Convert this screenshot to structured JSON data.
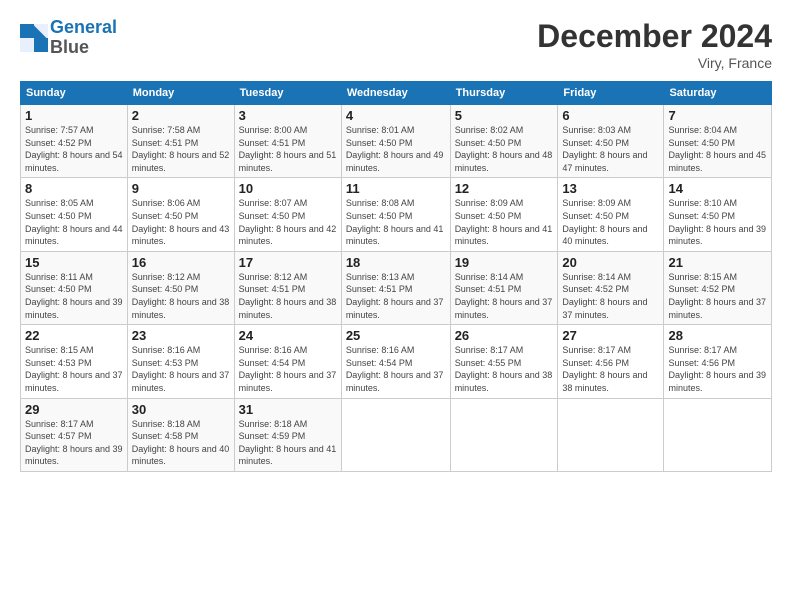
{
  "logo": {
    "line1": "General",
    "line2": "Blue"
  },
  "title": "December 2024",
  "location": "Viry, France",
  "headers": [
    "Sunday",
    "Monday",
    "Tuesday",
    "Wednesday",
    "Thursday",
    "Friday",
    "Saturday"
  ],
  "weeks": [
    [
      {
        "day": "1",
        "sunrise": "7:57 AM",
        "sunset": "4:52 PM",
        "daylight": "8 hours and 54 minutes."
      },
      {
        "day": "2",
        "sunrise": "7:58 AM",
        "sunset": "4:51 PM",
        "daylight": "8 hours and 52 minutes."
      },
      {
        "day": "3",
        "sunrise": "8:00 AM",
        "sunset": "4:51 PM",
        "daylight": "8 hours and 51 minutes."
      },
      {
        "day": "4",
        "sunrise": "8:01 AM",
        "sunset": "4:50 PM",
        "daylight": "8 hours and 49 minutes."
      },
      {
        "day": "5",
        "sunrise": "8:02 AM",
        "sunset": "4:50 PM",
        "daylight": "8 hours and 48 minutes."
      },
      {
        "day": "6",
        "sunrise": "8:03 AM",
        "sunset": "4:50 PM",
        "daylight": "8 hours and 47 minutes."
      },
      {
        "day": "7",
        "sunrise": "8:04 AM",
        "sunset": "4:50 PM",
        "daylight": "8 hours and 45 minutes."
      }
    ],
    [
      {
        "day": "8",
        "sunrise": "8:05 AM",
        "sunset": "4:50 PM",
        "daylight": "8 hours and 44 minutes."
      },
      {
        "day": "9",
        "sunrise": "8:06 AM",
        "sunset": "4:50 PM",
        "daylight": "8 hours and 43 minutes."
      },
      {
        "day": "10",
        "sunrise": "8:07 AM",
        "sunset": "4:50 PM",
        "daylight": "8 hours and 42 minutes."
      },
      {
        "day": "11",
        "sunrise": "8:08 AM",
        "sunset": "4:50 PM",
        "daylight": "8 hours and 41 minutes."
      },
      {
        "day": "12",
        "sunrise": "8:09 AM",
        "sunset": "4:50 PM",
        "daylight": "8 hours and 41 minutes."
      },
      {
        "day": "13",
        "sunrise": "8:09 AM",
        "sunset": "4:50 PM",
        "daylight": "8 hours and 40 minutes."
      },
      {
        "day": "14",
        "sunrise": "8:10 AM",
        "sunset": "4:50 PM",
        "daylight": "8 hours and 39 minutes."
      }
    ],
    [
      {
        "day": "15",
        "sunrise": "8:11 AM",
        "sunset": "4:50 PM",
        "daylight": "8 hours and 39 minutes."
      },
      {
        "day": "16",
        "sunrise": "8:12 AM",
        "sunset": "4:50 PM",
        "daylight": "8 hours and 38 minutes."
      },
      {
        "day": "17",
        "sunrise": "8:12 AM",
        "sunset": "4:51 PM",
        "daylight": "8 hours and 38 minutes."
      },
      {
        "day": "18",
        "sunrise": "8:13 AM",
        "sunset": "4:51 PM",
        "daylight": "8 hours and 37 minutes."
      },
      {
        "day": "19",
        "sunrise": "8:14 AM",
        "sunset": "4:51 PM",
        "daylight": "8 hours and 37 minutes."
      },
      {
        "day": "20",
        "sunrise": "8:14 AM",
        "sunset": "4:52 PM",
        "daylight": "8 hours and 37 minutes."
      },
      {
        "day": "21",
        "sunrise": "8:15 AM",
        "sunset": "4:52 PM",
        "daylight": "8 hours and 37 minutes."
      }
    ],
    [
      {
        "day": "22",
        "sunrise": "8:15 AM",
        "sunset": "4:53 PM",
        "daylight": "8 hours and 37 minutes."
      },
      {
        "day": "23",
        "sunrise": "8:16 AM",
        "sunset": "4:53 PM",
        "daylight": "8 hours and 37 minutes."
      },
      {
        "day": "24",
        "sunrise": "8:16 AM",
        "sunset": "4:54 PM",
        "daylight": "8 hours and 37 minutes."
      },
      {
        "day": "25",
        "sunrise": "8:16 AM",
        "sunset": "4:54 PM",
        "daylight": "8 hours and 37 minutes."
      },
      {
        "day": "26",
        "sunrise": "8:17 AM",
        "sunset": "4:55 PM",
        "daylight": "8 hours and 38 minutes."
      },
      {
        "day": "27",
        "sunrise": "8:17 AM",
        "sunset": "4:56 PM",
        "daylight": "8 hours and 38 minutes."
      },
      {
        "day": "28",
        "sunrise": "8:17 AM",
        "sunset": "4:56 PM",
        "daylight": "8 hours and 39 minutes."
      }
    ],
    [
      {
        "day": "29",
        "sunrise": "8:17 AM",
        "sunset": "4:57 PM",
        "daylight": "8 hours and 39 minutes."
      },
      {
        "day": "30",
        "sunrise": "8:18 AM",
        "sunset": "4:58 PM",
        "daylight": "8 hours and 40 minutes."
      },
      {
        "day": "31",
        "sunrise": "8:18 AM",
        "sunset": "4:59 PM",
        "daylight": "8 hours and 41 minutes."
      },
      null,
      null,
      null,
      null
    ]
  ]
}
